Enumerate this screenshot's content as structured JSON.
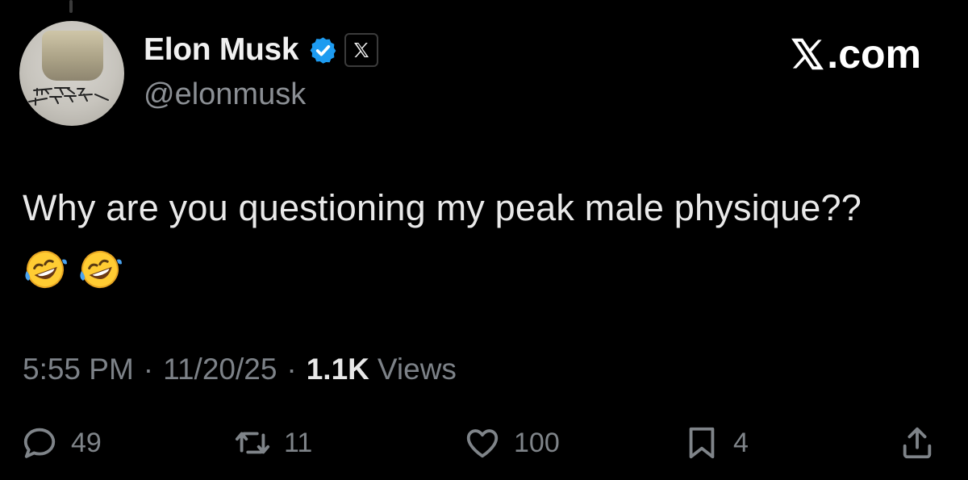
{
  "author": {
    "name": "Elon Musk",
    "handle": "@elonmusk",
    "avatar_text": "THE FUTURE IS ARRIVING",
    "verified_color": "#1d9bf0"
  },
  "brand": {
    "text": ".com",
    "logo_icon": "x-logo-icon"
  },
  "tweet": {
    "text": "Why are you questioning my peak male physique??",
    "emojis": [
      "🤣",
      "🤣"
    ]
  },
  "meta": {
    "time": "5:55 PM",
    "separator": "·",
    "date": "11/20/25",
    "views_count": "1.1K",
    "views_label": "Views"
  },
  "actions": {
    "replies": "49",
    "reposts": "11",
    "likes": "100",
    "bookmarks": "4"
  },
  "colors": {
    "background": "#000000",
    "text": "#e7e9ea",
    "secondary": "#7d8288"
  }
}
